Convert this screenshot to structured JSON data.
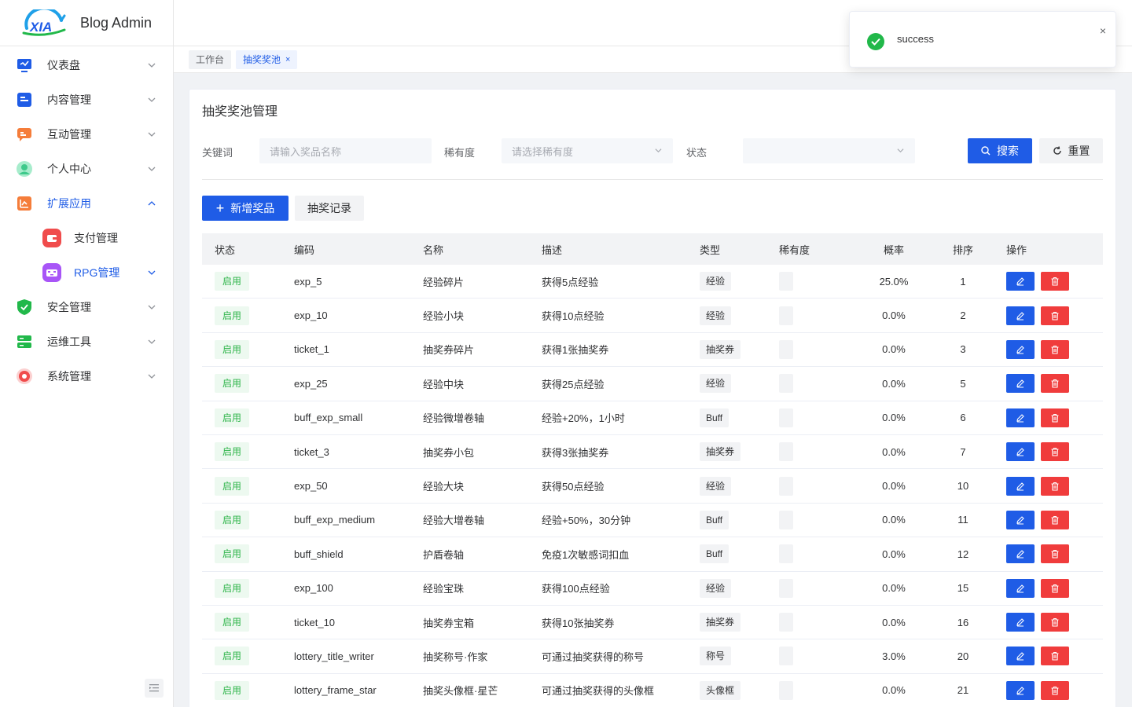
{
  "app": {
    "title": "Blog Admin",
    "logo_text": "XIA"
  },
  "sidebar": {
    "items": [
      {
        "label": "仪表盘",
        "icon": "dashboard-icon",
        "color": "#1f5ce6"
      },
      {
        "label": "内容管理",
        "icon": "document-icon",
        "color": "#1f5ce6"
      },
      {
        "label": "互动管理",
        "icon": "chat-icon",
        "color": "#f57d3a"
      },
      {
        "label": "个人中心",
        "icon": "user-icon",
        "color": "#3ec98b"
      },
      {
        "label": "扩展应用",
        "icon": "extension-icon",
        "color": "#f57d3a",
        "expanded": true
      },
      {
        "label": "安全管理",
        "icon": "shield-icon",
        "color": "#21b84a"
      },
      {
        "label": "运维工具",
        "icon": "server-icon",
        "color": "#21b84a"
      },
      {
        "label": "系统管理",
        "icon": "settings-icon",
        "color": "#f04c4c"
      }
    ],
    "sub_items": [
      {
        "label": "支付管理",
        "icon": "wallet-icon",
        "color": "#f04c4c"
      },
      {
        "label": "RPG管理",
        "icon": "game-icon",
        "color": "#a855f7"
      }
    ]
  },
  "tabs": [
    {
      "label": "工作台"
    },
    {
      "label": "抽奖奖池",
      "close": "×"
    }
  ],
  "page": {
    "title": "抽奖奖池管理",
    "filters": {
      "keyword_label": "关键词",
      "keyword_placeholder": "请输入奖品名称",
      "rarity_label": "稀有度",
      "rarity_placeholder": "请选择稀有度",
      "status_label": "状态",
      "status_value": ""
    },
    "search_label": "搜索",
    "reset_label": "重置",
    "add_label": "新增奖品",
    "records_label": "抽奖记录"
  },
  "table": {
    "headers": [
      "状态",
      "编码",
      "名称",
      "描述",
      "类型",
      "稀有度",
      "概率",
      "排序",
      "操作"
    ],
    "rows": [
      {
        "status": "启用",
        "code": "exp_5",
        "name": "经验碎片",
        "desc": "获得5点经验",
        "type": "经验",
        "prob": "25.0%",
        "sort": "1"
      },
      {
        "status": "启用",
        "code": "exp_10",
        "name": "经验小块",
        "desc": "获得10点经验",
        "type": "经验",
        "prob": "0.0%",
        "sort": "2"
      },
      {
        "status": "启用",
        "code": "ticket_1",
        "name": "抽奖券碎片",
        "desc": "获得1张抽奖券",
        "type": "抽奖券",
        "prob": "0.0%",
        "sort": "3"
      },
      {
        "status": "启用",
        "code": "exp_25",
        "name": "经验中块",
        "desc": "获得25点经验",
        "type": "经验",
        "prob": "0.0%",
        "sort": "5"
      },
      {
        "status": "启用",
        "code": "buff_exp_small",
        "name": "经验微增卷轴",
        "desc": "经验+20%，1小时",
        "type": "Buff",
        "prob": "0.0%",
        "sort": "6"
      },
      {
        "status": "启用",
        "code": "ticket_3",
        "name": "抽奖券小包",
        "desc": "获得3张抽奖券",
        "type": "抽奖券",
        "prob": "0.0%",
        "sort": "7"
      },
      {
        "status": "启用",
        "code": "exp_50",
        "name": "经验大块",
        "desc": "获得50点经验",
        "type": "经验",
        "prob": "0.0%",
        "sort": "10"
      },
      {
        "status": "启用",
        "code": "buff_exp_medium",
        "name": "经验大增卷轴",
        "desc": "经验+50%，30分钟",
        "type": "Buff",
        "prob": "0.0%",
        "sort": "11"
      },
      {
        "status": "启用",
        "code": "buff_shield",
        "name": "护盾卷轴",
        "desc": "免疫1次敏感词扣血",
        "type": "Buff",
        "prob": "0.0%",
        "sort": "12"
      },
      {
        "status": "启用",
        "code": "exp_100",
        "name": "经验宝珠",
        "desc": "获得100点经验",
        "type": "经验",
        "prob": "0.0%",
        "sort": "15"
      },
      {
        "status": "启用",
        "code": "ticket_10",
        "name": "抽奖券宝箱",
        "desc": "获得10张抽奖券",
        "type": "抽奖券",
        "prob": "0.0%",
        "sort": "16"
      },
      {
        "status": "启用",
        "code": "lottery_title_writer",
        "name": "抽奖称号·作家",
        "desc": "可通过抽奖获得的称号",
        "type": "称号",
        "prob": "3.0%",
        "sort": "20"
      },
      {
        "status": "启用",
        "code": "lottery_frame_star",
        "name": "抽奖头像框·星芒",
        "desc": "可通过抽奖获得的头像框",
        "type": "头像框",
        "prob": "0.0%",
        "sort": "21"
      }
    ]
  },
  "toast": {
    "message": "success",
    "close": "×"
  },
  "colors": {
    "primary": "#1f5ce6",
    "success": "#21b84a",
    "danger": "#f03c3c"
  }
}
